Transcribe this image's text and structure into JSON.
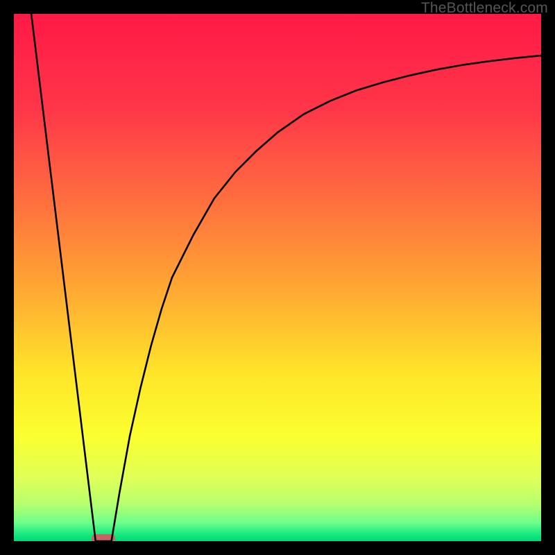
{
  "watermark": "TheBottleneck.com",
  "chart_data": {
    "type": "line",
    "title": "",
    "xlabel": "",
    "ylabel": "",
    "xlim": [
      0,
      100
    ],
    "ylim": [
      0,
      100
    ],
    "series": [
      {
        "name": "left-branch",
        "x": [
          3.3,
          15.5
        ],
        "values": [
          100,
          0
        ]
      },
      {
        "name": "right-branch",
        "x": [
          18.5,
          20,
          22,
          24,
          26,
          28,
          30,
          34,
          38,
          42,
          46,
          50,
          55,
          60,
          65,
          70,
          75,
          80,
          85,
          90,
          95,
          100
        ],
        "values": [
          0,
          9,
          20,
          29,
          37,
          44,
          50,
          58,
          65,
          70,
          74,
          77.5,
          81,
          83.5,
          85.5,
          87,
          88.3,
          89.4,
          90.3,
          91,
          91.6,
          92.1
        ]
      }
    ],
    "marker": {
      "x_center": 17,
      "width": 4.5,
      "color": "#c96262"
    },
    "gradient_stops": [
      {
        "offset": 0,
        "color": "#ff1a46"
      },
      {
        "offset": 18,
        "color": "#ff3649"
      },
      {
        "offset": 35,
        "color": "#ff6d3f"
      },
      {
        "offset": 52,
        "color": "#ffa733"
      },
      {
        "offset": 68,
        "color": "#ffe429"
      },
      {
        "offset": 80,
        "color": "#fbff2f"
      },
      {
        "offset": 88,
        "color": "#e0ff57"
      },
      {
        "offset": 93,
        "color": "#b6ff6f"
      },
      {
        "offset": 96.5,
        "color": "#6dff8a"
      },
      {
        "offset": 98.7,
        "color": "#16e97f"
      },
      {
        "offset": 100,
        "color": "#00d877"
      }
    ]
  }
}
